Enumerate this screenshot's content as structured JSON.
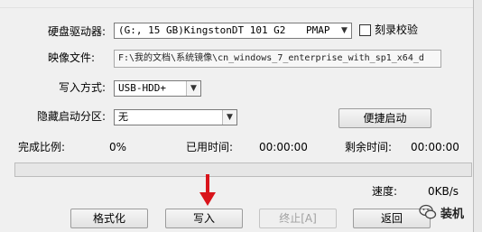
{
  "drive": {
    "label": "硬盘驱动器:",
    "value": "(G:, 15 GB)KingstonDT 101 G2",
    "format": "PMAP",
    "verify_label": "刻录校验",
    "verify_checked": false
  },
  "image_file": {
    "label": "映像文件:",
    "value": "F:\\我的文档\\系统镜像\\cn_windows_7_enterprise_with_sp1_x64_d"
  },
  "write_mode": {
    "label": "写入方式:",
    "value": "USB-HDD+"
  },
  "hidden_partition": {
    "label": "隐藏启动分区:",
    "value": "无"
  },
  "quick_boot_label": "便捷启动",
  "status": {
    "complete_label": "完成比例:",
    "complete_value": "0%",
    "elapsed_label": "已用时间:",
    "elapsed_value": "00:00:00",
    "remaining_label": "剩余时间:",
    "remaining_value": "00:00:00",
    "speed_label": "速度:",
    "speed_value": "0KB/s",
    "progress_fraction": 0
  },
  "buttons": {
    "format": "格式化",
    "write": "写入",
    "stop": "终止[A]",
    "back": "返回"
  },
  "watermark": "装机",
  "colors": {
    "arrow": "#d9141b",
    "progress": "#06b025"
  }
}
